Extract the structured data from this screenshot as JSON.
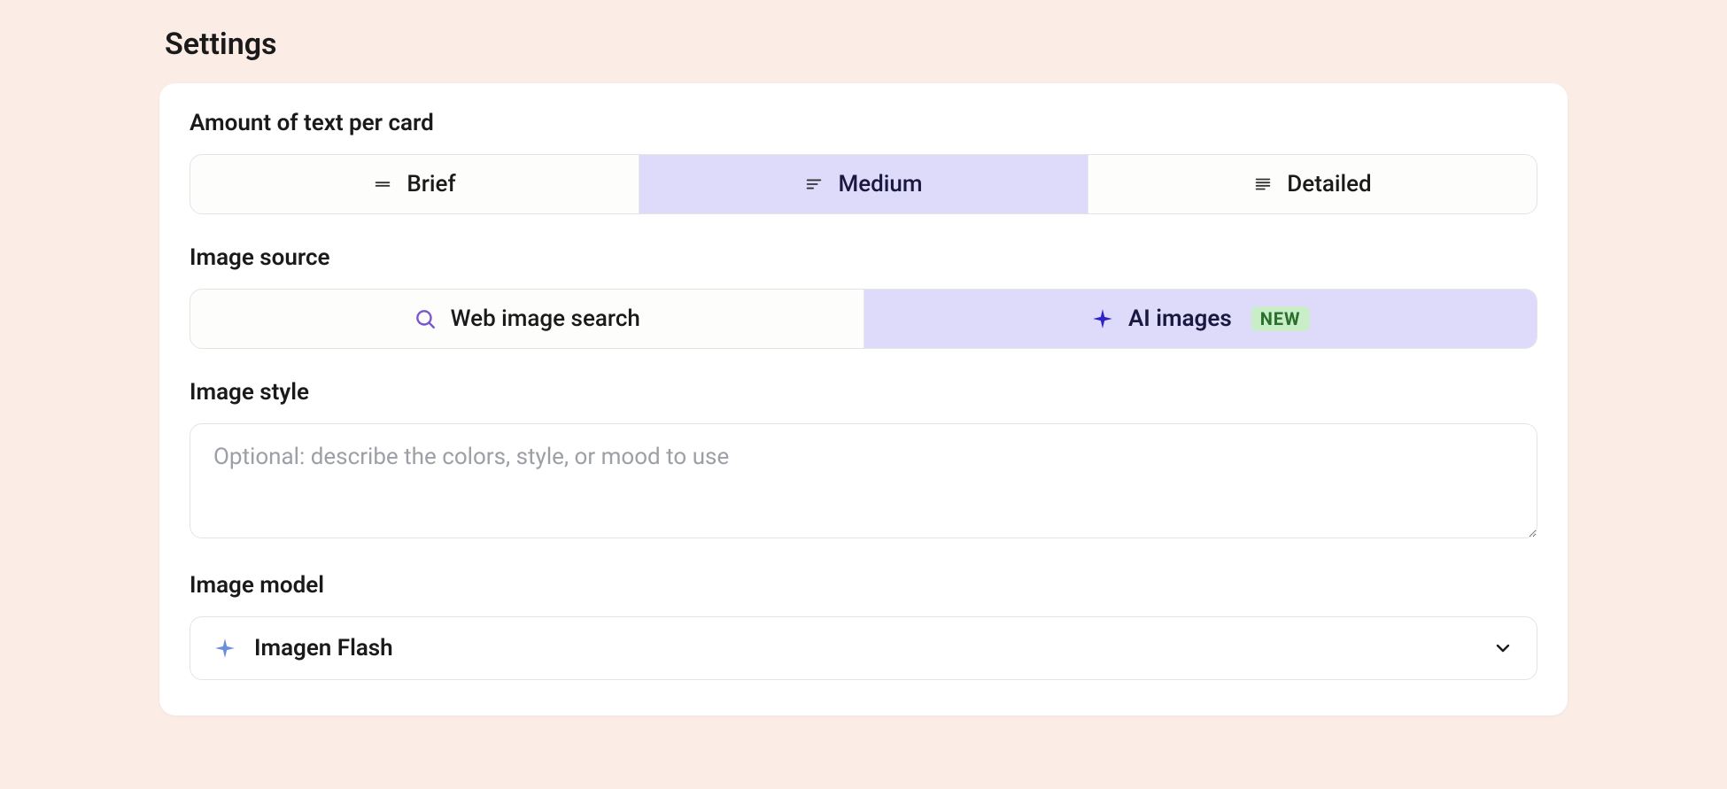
{
  "title": "Settings",
  "amount_of_text": {
    "label": "Amount of text per card",
    "options": {
      "brief": "Brief",
      "medium": "Medium",
      "detailed": "Detailed"
    },
    "selected": "medium"
  },
  "image_source": {
    "label": "Image source",
    "options": {
      "web": "Web image search",
      "ai": "AI images"
    },
    "ai_badge": "NEW",
    "selected": "ai"
  },
  "image_style": {
    "label": "Image style",
    "placeholder": "Optional: describe the colors, style, or mood to use",
    "value": ""
  },
  "image_model": {
    "label": "Image model",
    "selected": "Imagen Flash"
  },
  "colors": {
    "selected_bg": "#dedbfa",
    "accent_sparkle": "#2e24c8",
    "model_sparkle": "#6d8fd9",
    "search_icon": "#7a55d1",
    "badge_bg": "#c8edc7",
    "badge_text": "#2a6f2c"
  }
}
